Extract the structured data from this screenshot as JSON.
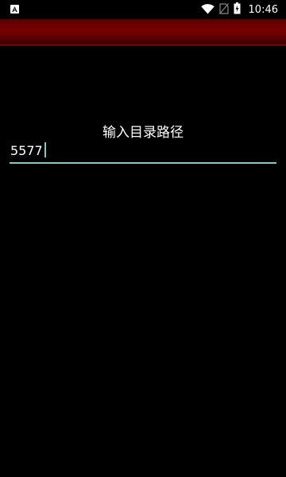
{
  "status_bar": {
    "time": "10:46",
    "icons": [
      "notification-a-icon",
      "wifi-icon",
      "no-sim-icon",
      "battery-charging-icon"
    ]
  },
  "dialog": {
    "prompt": "输入目录路径",
    "input_value": "5577"
  },
  "colors": {
    "app_bar": "#6a0000",
    "input_underline": "#80cbc4",
    "background": "#000000"
  }
}
